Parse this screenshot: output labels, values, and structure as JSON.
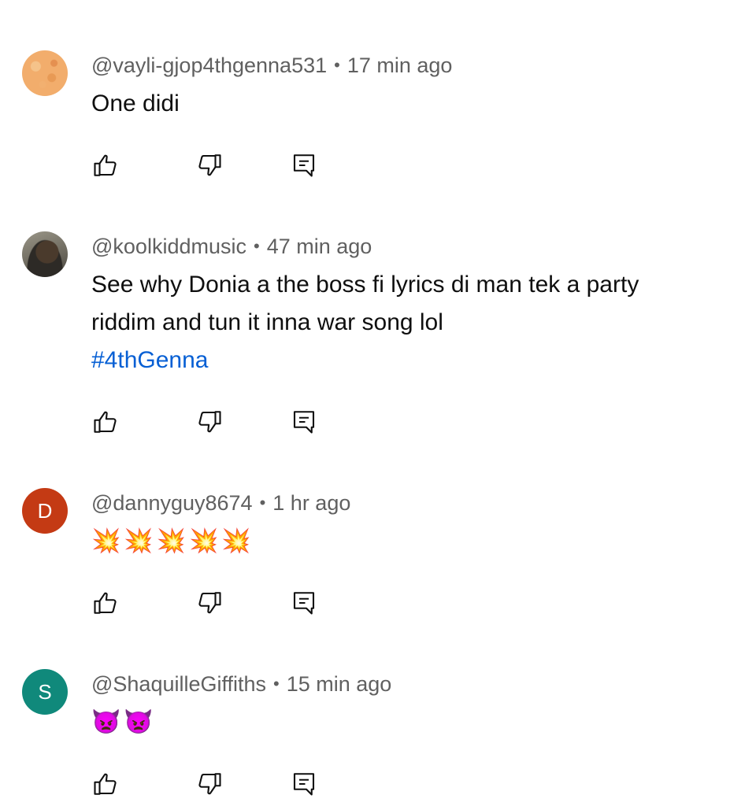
{
  "comments": [
    {
      "avatar_letter": "",
      "author": "@vayli-gjop4thgenna531",
      "separator": "•",
      "time": "17 min ago",
      "text": "One didi",
      "hashtag": ""
    },
    {
      "avatar_letter": "",
      "author": "@koolkiddmusic",
      "separator": "•",
      "time": "47 min ago",
      "text": "See why Donia a the boss fi lyrics di man tek a party riddim and tun it inna war song lol",
      "hashtag": "#4thGenna"
    },
    {
      "avatar_letter": "D",
      "author": "@dannyguy8674",
      "separator": "•",
      "time": "1 hr ago",
      "text": "💥💥💥💥💥",
      "hashtag": ""
    },
    {
      "avatar_letter": "S",
      "author": "@ShaquilleGiffiths",
      "separator": "•",
      "time": "15 min ago",
      "text": "👿👿",
      "hashtag": ""
    }
  ],
  "icons": {
    "like": "thumbs-up-icon",
    "dislike": "thumbs-down-icon",
    "reply": "reply-comment-icon"
  },
  "colors": {
    "text": "#0f0f0f",
    "meta": "#606060",
    "link": "#065fd4",
    "avatar_d": "#c43a14",
    "avatar_s": "#10897b"
  }
}
